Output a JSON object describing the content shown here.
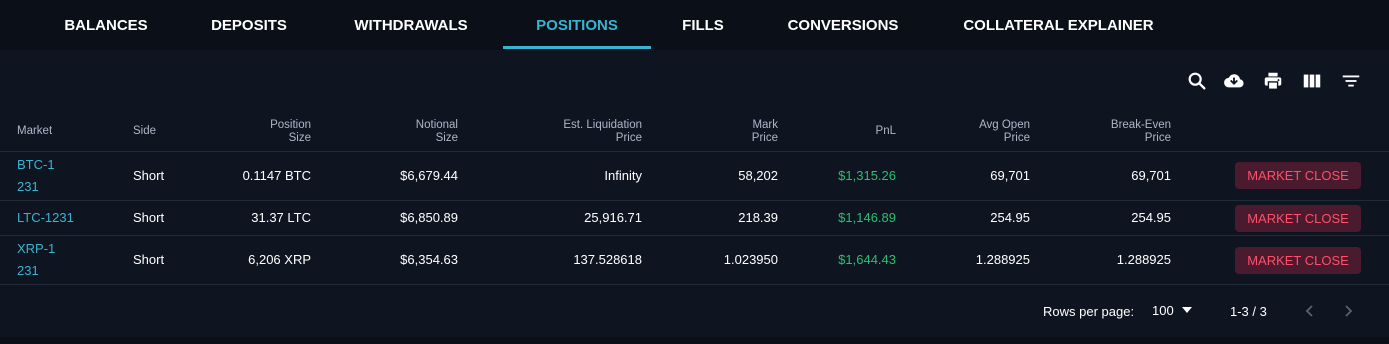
{
  "tabs": [
    {
      "label": "BALANCES"
    },
    {
      "label": "DEPOSITS"
    },
    {
      "label": "WITHDRAWALS"
    },
    {
      "label": "POSITIONS"
    },
    {
      "label": "FILLS"
    },
    {
      "label": "CONVERSIONS"
    },
    {
      "label": "COLLATERAL EXPLAINER"
    }
  ],
  "active_tab": "POSITIONS",
  "toolbar_icons": [
    "search-icon",
    "download-icon",
    "print-icon",
    "view-columns-icon",
    "filter-icon"
  ],
  "columns": {
    "market": "Market",
    "side": "Side",
    "position_size": [
      "Position",
      "Size"
    ],
    "notional_size": [
      "Notional",
      "Size"
    ],
    "est_liq_price": [
      "Est. Liquidation",
      "Price"
    ],
    "mark_price": [
      "Mark",
      "Price"
    ],
    "pnl": "PnL",
    "avg_open_price": [
      "Avg Open",
      "Price"
    ],
    "break_even_price": [
      "Break-Even",
      "Price"
    ]
  },
  "rows": [
    {
      "market": "BTC-1231",
      "side": "Short",
      "position_size": "0.1147 BTC",
      "notional_size": "$6,679.44",
      "est_liq_price": "Infinity",
      "mark_price": "58,202",
      "pnl": "$1,315.26",
      "avg_open_price": "69,701",
      "break_even_price": "69,701",
      "action": "MARKET CLOSE"
    },
    {
      "market": "LTC-1231",
      "side": "Short",
      "position_size": "31.37 LTC",
      "notional_size": "$6,850.89",
      "est_liq_price": "25,916.71",
      "mark_price": "218.39",
      "pnl": "$1,146.89",
      "avg_open_price": "254.95",
      "break_even_price": "254.95",
      "action": "MARKET CLOSE"
    },
    {
      "market": "XRP-1231",
      "side": "Short",
      "position_size": "6,206 XRP",
      "notional_size": "$6,354.63",
      "est_liq_price": "137.528618",
      "mark_price": "1.023950",
      "pnl": "$1,644.43",
      "avg_open_price": "1.288925",
      "break_even_price": "1.288925",
      "action": "MARKET CLOSE"
    }
  ],
  "pagination": {
    "rows_per_page_label": "Rows per page:",
    "rows_per_page_value": "100",
    "range": "1-3 / 3"
  },
  "colors": {
    "background": "#0f1421",
    "accent": "#3ab3d0",
    "pnl_positive": "#2bbf6e",
    "market_close_text": "#ff4f6a",
    "market_close_bg": "#4a1b2e"
  }
}
